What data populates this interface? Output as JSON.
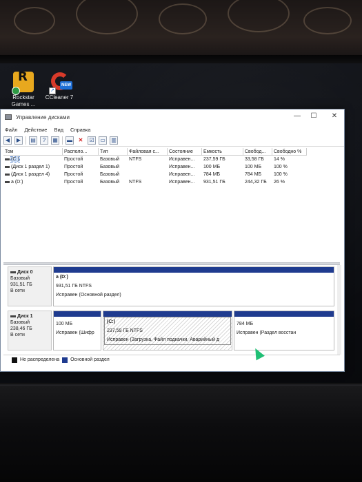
{
  "desktop": {
    "icons": [
      {
        "label_line1": "Rockstar",
        "label_line2": "Games ...",
        "icon": "rockstar-games-icon"
      },
      {
        "label_line1": "CCleaner 7",
        "label_line2": "",
        "icon": "ccleaner-icon",
        "badge": "NEW"
      }
    ]
  },
  "window": {
    "title": "Управление дисками",
    "buttons": {
      "minimize": "—",
      "maximize": "☐",
      "close": "✕"
    }
  },
  "menu": {
    "items": [
      "Файл",
      "Действие",
      "Вид",
      "Справка"
    ]
  },
  "toolbar": {
    "icons": [
      "back-arrow-icon",
      "forward-arrow-icon",
      "console-tree-icon",
      "help-icon",
      "properties-icon",
      "connect-icon",
      "delete-icon",
      "check-icon",
      "folder-icon",
      "list-icon"
    ],
    "glyphs": [
      "◀",
      "▶",
      "▤",
      "?",
      "▦",
      "▬",
      "✕",
      "☑",
      "▭",
      "▥"
    ]
  },
  "volumes": {
    "columns": [
      "Том",
      "Располо...",
      "Тип",
      "Файловая с...",
      "Состояние",
      "Емкость",
      "Свобод...",
      "Свободно %"
    ],
    "rows": [
      {
        "tom": "(C:)",
        "loc": "Простой",
        "type": "Базовый",
        "fs": "NTFS",
        "state": "Исправен...",
        "cap": "237,59 ГБ",
        "free": "33,58 ГБ",
        "pct": "14 %"
      },
      {
        "tom": "(Диск 1 раздел 1)",
        "loc": "Простой",
        "type": "Базовый",
        "fs": "",
        "state": "Исправен...",
        "cap": "100 МБ",
        "free": "100 МБ",
        "pct": "100 %"
      },
      {
        "tom": "(Диск 1 раздел 4)",
        "loc": "Простой",
        "type": "Базовый",
        "fs": "",
        "state": "Исправен...",
        "cap": "784 МБ",
        "free": "784 МБ",
        "pct": "100 %"
      },
      {
        "tom": "a (D:)",
        "loc": "Простой",
        "type": "Базовый",
        "fs": "NTFS",
        "state": "Исправен...",
        "cap": "931,51 ГБ",
        "free": "244,32 ГБ",
        "pct": "26 %"
      }
    ]
  },
  "disks": [
    {
      "name": "Диск 0",
      "kind": "Базовый",
      "size": "931,51 ГБ",
      "status": "В сети",
      "partitions": [
        {
          "title": "a  (D:)",
          "size": "931,51 ГБ NTFS",
          "state": "Исправен (Основной раздел)"
        }
      ]
    },
    {
      "name": "Диск 1",
      "kind": "Базовый",
      "size": "238,46 ГБ",
      "status": "В сети",
      "partitions": [
        {
          "title": "",
          "size": "100 МБ",
          "state": "Исправен (Шифр"
        },
        {
          "title": "(C:)",
          "size": "237,59 ГБ NTFS",
          "state": "Исправен (Загрузка, Файл подкачки, Аварийный д"
        },
        {
          "title": "",
          "size": "784 МБ",
          "state": "Исправен (Раздел восстан"
        }
      ]
    }
  ],
  "legend": {
    "unallocated": "Не распределена",
    "primary": "Основной раздел"
  },
  "colors": {
    "partition_stripe": "#1f3b8f",
    "unallocated": "#111111",
    "cursor": "#1fbf74"
  }
}
